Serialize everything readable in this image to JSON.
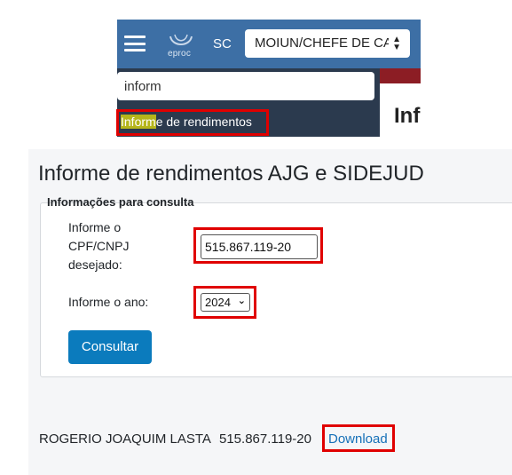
{
  "header": {
    "region": "SC",
    "role_selector": "MOIUN/CHEFE DE CA",
    "logo_text": "eproc"
  },
  "sidebar": {
    "search_value": "inform",
    "result_highlight": "Inform",
    "result_rest": "e de rendimentos"
  },
  "main_peek": {
    "title_fragment": "Inf"
  },
  "page": {
    "title": "Informe de rendimentos AJG e SIDEJUD"
  },
  "form": {
    "legend": "Informações para consulta",
    "cpf_label": "Informe o CPF/CNPJ desejado:",
    "cpf_label_lines": [
      "Informe o",
      "CPF/CNPJ",
      "desejado:"
    ],
    "cpf_value": "515.867.119-20",
    "year_label": "Informe o ano:",
    "year_value": "2024",
    "submit_label": "Consultar"
  },
  "result": {
    "name": "ROGERIO JOAQUIM LASTA",
    "cpf": "515.867.119-20",
    "link_label": "Download"
  },
  "colors": {
    "navbar": "#3d6fa5",
    "sidebar": "#2b3a4e",
    "button": "#0b7bbd",
    "highlight_box": "#e00000",
    "link": "#1570b8"
  },
  "icons": [
    "hamburger-menu-icon",
    "eproc-logo",
    "select-arrows-icon",
    "chevron-down-icon"
  ]
}
